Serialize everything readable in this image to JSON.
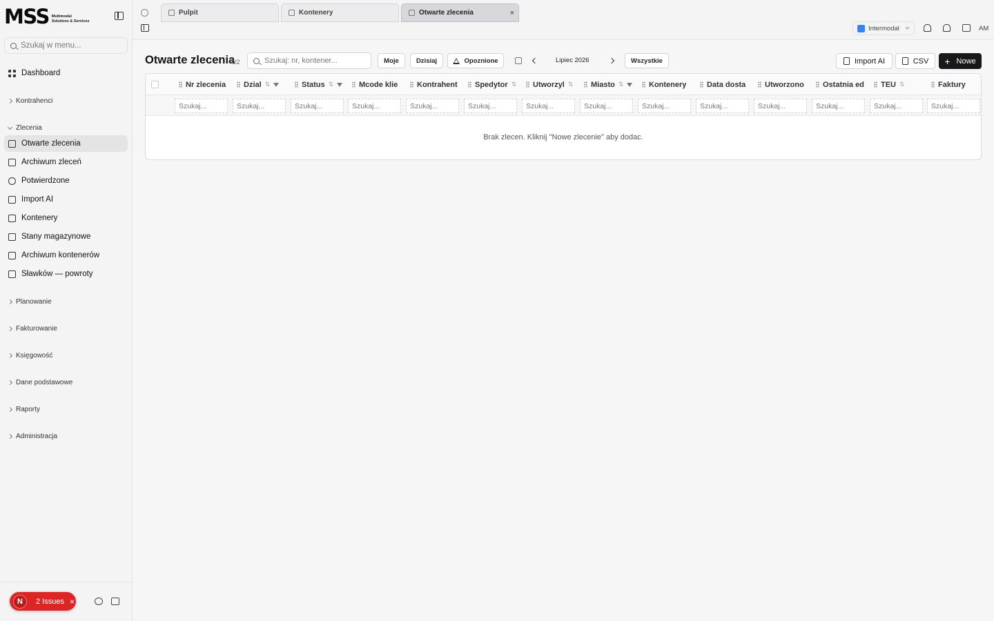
{
  "brand": {
    "name": "MSS",
    "sub_line1": "Multimodal",
    "sub_line2": "Solutions & Services"
  },
  "sidebar": {
    "search_placeholder": "Szukaj w menu...",
    "dashboard": "Dashboard",
    "groups": {
      "kontrahenci": "Kontrahenci",
      "zlecenia": "Zlecenia",
      "planowanie": "Planowanie",
      "fakturowanie": "Fakturowanie",
      "ksiegowosc": "Księgowość",
      "dane": "Dane podstawowe",
      "raporty": "Raporty",
      "administracja": "Administracja"
    },
    "items": [
      {
        "label": "Otwarte zlecenia",
        "icon": "document-icon",
        "active": true
      },
      {
        "label": "Archiwum zleceń",
        "icon": "archive-icon"
      },
      {
        "label": "Potwierdzone",
        "icon": "check-circle-icon"
      },
      {
        "label": "Import AI",
        "icon": "file-import-icon"
      },
      {
        "label": "Kontenery",
        "icon": "box-icon"
      },
      {
        "label": "Stany magazynowe",
        "icon": "database-icon"
      },
      {
        "label": "Archiwum kontenerów",
        "icon": "archive-icon"
      },
      {
        "label": "Sławków — powroty",
        "icon": "archive-icon"
      }
    ],
    "issues": {
      "badge": "N",
      "label": "2 Issues",
      "close": "×"
    }
  },
  "tabs": [
    {
      "label": "Pulpit"
    },
    {
      "label": "Kontenery"
    },
    {
      "label": "Otwarte zlecenia",
      "active": true,
      "close": "×"
    }
  ],
  "topbar": {
    "company": "Intermodal",
    "user": "AM"
  },
  "main": {
    "title": "Otwarte zlecenia",
    "count": "0/2",
    "search_placeholder": "Szukaj: nr, kontener...",
    "filters": {
      "moje": "Moje",
      "dzisiaj": "Dzisiaj",
      "opoznione": "Opoznione",
      "wszystkie": "Wszystkie"
    },
    "month": "Lipiec 2026",
    "actions": {
      "import": "Import AI",
      "csv": "CSV",
      "new": "Nowe"
    }
  },
  "table": {
    "columns": [
      "Nr zlecenia",
      "Dzial",
      "Status",
      "Mcode klie",
      "Kontrahent",
      "Spedytor",
      "Utworzyl",
      "Miasto",
      "Kontenery",
      "Data dosta",
      "Utworzono",
      "Ostatnia ed",
      "TEU",
      "Faktury"
    ],
    "filter_placeholder": "Szukaj...",
    "empty_message": "Brak zlecen. Kliknij \"Nowe zlecenie\" aby dodac."
  },
  "colors": {
    "accent": "#18181b",
    "issues": "#dc2626",
    "company": "#3b82f6"
  }
}
